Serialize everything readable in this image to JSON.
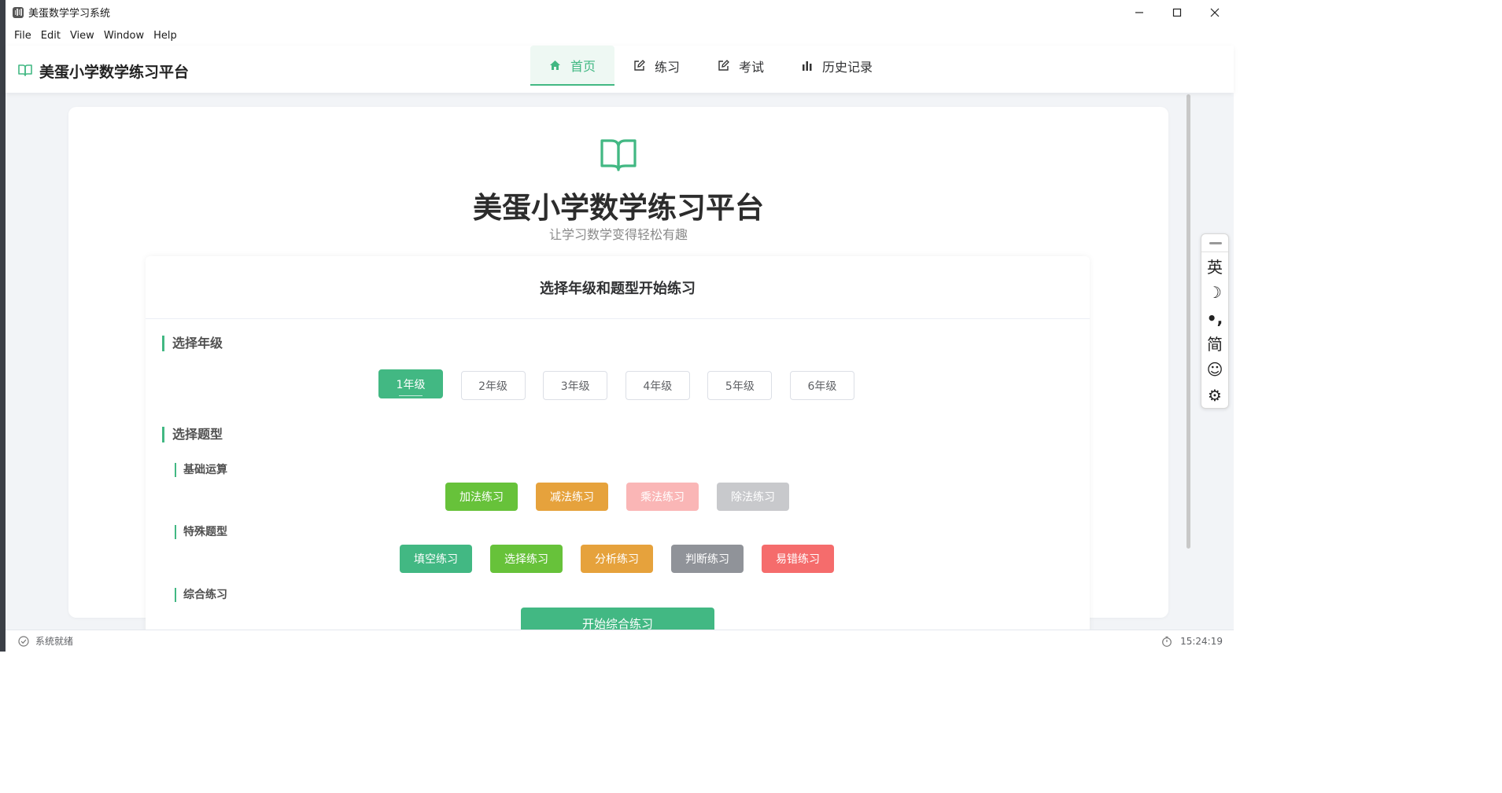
{
  "window": {
    "title": "美蛋数学学习系统",
    "controls": [
      "—",
      "☐",
      "✕"
    ]
  },
  "menu": [
    "File",
    "Edit",
    "View",
    "Window",
    "Help"
  ],
  "header": {
    "brand": "美蛋小学数学练习平台",
    "tabs": [
      {
        "label": "首页",
        "icon": "home-icon",
        "active": true
      },
      {
        "label": "练习",
        "icon": "edit-icon",
        "active": false
      },
      {
        "label": "考试",
        "icon": "edit-icon",
        "active": false
      },
      {
        "label": "历史记录",
        "icon": "bar-chart-icon",
        "active": false
      }
    ]
  },
  "hero": {
    "title": "美蛋小学数学练习平台",
    "subtitle": "让学习数学变得轻松有趣"
  },
  "panel": {
    "title": "选择年级和题型开始练习",
    "grade_section": "选择年级",
    "grades": [
      "1年级",
      "2年级",
      "3年级",
      "4年级",
      "5年级",
      "6年级"
    ],
    "selected_grade": "1年级",
    "type_section": "选择题型",
    "basic": {
      "title": "基础运算",
      "buttons": [
        {
          "label": "加法练习",
          "color": "#67c23a"
        },
        {
          "label": "减法练习",
          "color": "#e6a23c"
        },
        {
          "label": "乘法练习",
          "color": "#fab6b6"
        },
        {
          "label": "除法练习",
          "color": "#c8c9cc"
        }
      ]
    },
    "special": {
      "title": "特殊题型",
      "buttons": [
        {
          "label": "填空练习",
          "color": "#42b883"
        },
        {
          "label": "选择练习",
          "color": "#67c23a"
        },
        {
          "label": "分析练习",
          "color": "#e6a23c"
        },
        {
          "label": "判断练习",
          "color": "#909399"
        },
        {
          "label": "易错练习",
          "color": "#f56c6c"
        }
      ]
    },
    "comprehensive": {
      "title": "综合练习",
      "start_label": "开始综合练习"
    }
  },
  "status": {
    "left": "系统就绪",
    "time": "15:24:19"
  },
  "ime": {
    "items": [
      "英",
      "☽",
      "•,",
      "简",
      "☺",
      "⚙"
    ]
  },
  "colors": {
    "accent": "#42b883"
  }
}
